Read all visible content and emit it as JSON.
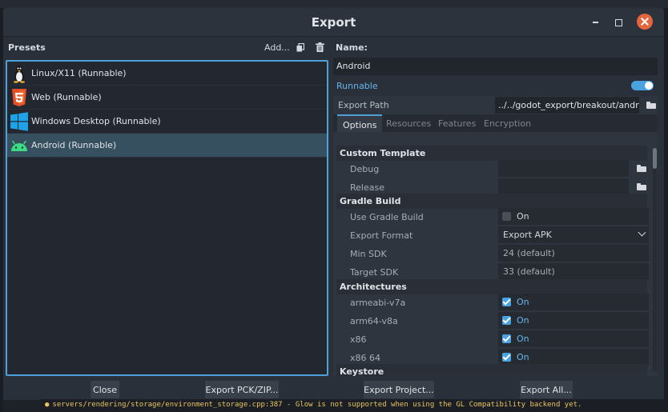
{
  "window": {
    "title": "Export"
  },
  "presets": {
    "label": "Presets",
    "add_label": "Add...",
    "items": [
      {
        "label": "Linux/X11 (Runnable)",
        "icon": "linux-tux-icon"
      },
      {
        "label": "Web (Runnable)",
        "icon": "html5-icon"
      },
      {
        "label": "Windows Desktop (Runnable)",
        "icon": "windows-icon"
      },
      {
        "label": "Android (Runnable)",
        "icon": "android-icon",
        "selected": true
      }
    ]
  },
  "details": {
    "name_label": "Name:",
    "name_value": "Android",
    "runnable_label": "Runnable",
    "runnable_on": true,
    "export_path_label": "Export Path",
    "export_path_value": "../../godot_export/breakout/android"
  },
  "tabs": [
    "Options",
    "Resources",
    "Features",
    "Encryption"
  ],
  "options": {
    "custom_template": "Custom Template",
    "debug": "Debug",
    "release": "Release",
    "gradle_build": "Gradle Build",
    "use_gradle_build": "Use Gradle Build",
    "use_gradle_value": "On",
    "export_format": "Export Format",
    "export_format_value": "Export APK",
    "min_sdk": "Min SDK",
    "min_sdk_value": "24 (default)",
    "target_sdk": "Target SDK",
    "target_sdk_value": "33 (default)",
    "architectures": "Architectures",
    "arch": [
      {
        "label": "armeabi-v7a",
        "value": "On"
      },
      {
        "label": "arm64-v8a",
        "value": "On"
      },
      {
        "label": "x86",
        "value": "On"
      },
      {
        "label": "x86 64",
        "value": "On"
      }
    ],
    "keystore": "Keystore"
  },
  "buttons": {
    "close": "Close",
    "export_pck": "Export PCK/ZIP...",
    "export_project": "Export Project...",
    "export_all": "Export All..."
  },
  "console": {
    "message": "servers/rendering/storage/environment_storage.cpp:387 - Glow is not supported when using the GL Compatibility backend yet."
  },
  "colors": {
    "accent": "#4ea1d8",
    "warning": "#e8c460",
    "close_button": "#e5663c"
  }
}
